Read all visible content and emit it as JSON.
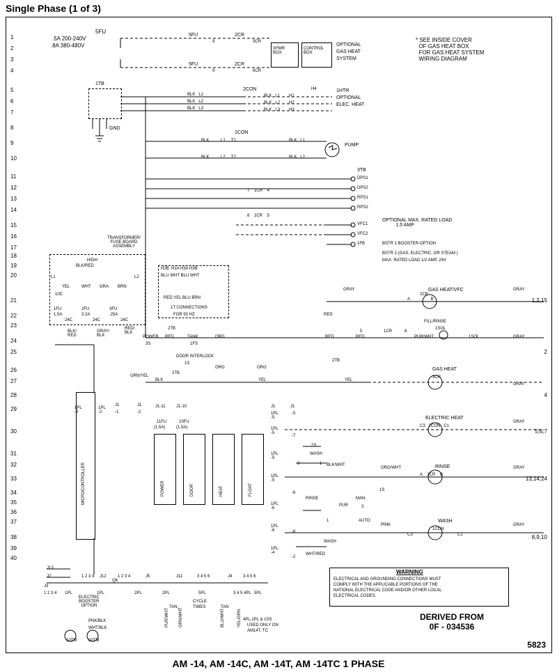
{
  "title": "Single Phase (1 of 3)",
  "caption": "AM -14, AM -14C, AM -14T, AM -14TC 1 PHASE",
  "drawing_no": "5823",
  "rows": [
    "1",
    "2",
    "3",
    "4",
    "5",
    "6",
    "7",
    "8",
    "9",
    "10",
    "11",
    "12",
    "13",
    "14",
    "15",
    "16",
    "17",
    "18",
    "19",
    "20",
    "21",
    "22",
    "23",
    "24",
    "25",
    "26",
    "27",
    "28",
    "29",
    "30",
    "31",
    "32",
    "33",
    "34",
    "35",
    "36",
    "37",
    "38",
    "39",
    "40"
  ],
  "row_ends": {
    "r21": "1,2,15",
    "r25": "2",
    "r28": "4",
    "r30": "5,6,7",
    "r33": "13,14,24",
    "r38": "8,9,10"
  },
  "labels": {
    "top_5fu1": "5FU",
    "top_5fu2": ".5A 200-240V",
    "top_5fu3": ".8A 380-480V",
    "xfmr": "XFMR\nBOX",
    "control_box": "CONTROL\nBOX",
    "optional_gas1": "OPTIONAL",
    "optional_gas2": "GAS HEAT",
    "optional_gas3": "SYSTEM",
    "tb1": "1TB",
    "tb2": "2TB",
    "tb3": "3TB",
    "con1": "1CON",
    "con2": "2CON",
    "blk_l1": "BLK   L1",
    "blk_l2": "BLK   L2",
    "blk_l3": "BLK   L3",
    "h1": "H1",
    "h2": "H2",
    "h3": "H3",
    "h4": "H4",
    "htr1": "1HTR",
    "optional_eh": "OPTIONAL",
    "elec_heat": "ELEC. HEAT",
    "gnd": "GND",
    "pump": "PUMP",
    "dps1": "DPS1",
    "dps2": "DPS2",
    "rps1": "RPS1",
    "rps2": "RPS2",
    "vfc1": "VFC1",
    "vfc2": "VFC2",
    "fb1": "1FB",
    "optional_amp": "OPTIONAL MAX. RATED LOAD\n          1.5 AMP",
    "xfmr_fuse": "TRANSFORMER/\nFUSE BOARD\nASSEMBLY",
    "high": "HIGH",
    "fu1": "1FU",
    "a1_5": "1.5A",
    "fu2": "2FU",
    "a3_2": "3.2A",
    "fu3": "3FU",
    "a25": ".25A",
    "c24": "24C",
    "c10": "10C",
    "t1_conn": "1T CONNECTIONS",
    "for50hz": "FOR 50 HZ",
    "bstr1": "BSTR 1 BOOSTER-OPTION",
    "bstr2": "BSTR 2 (GAS, ELECTRIC, OR STEAM )",
    "bstr2b": "MAX. RATED LOAD 1/2 AMP, 24V",
    "gas_heat_vfc": "GAS HEAT/VFC",
    "a_b": "A                  B",
    "cr2": "2CR",
    "cr1": "1CR",
    "cr3": "3CR",
    "fill_rinse": "FILL/RINSE",
    "sol1": "1SOL",
    "power": "POWER",
    "s3": "3S",
    "tank": "TANK",
    "fs1": "1FS",
    "door_int": "DOOR INTERLOCK",
    "s1": "1S",
    "gas_heat": "GAS HEAT",
    "elec_heat2": "ELECTRIC HEAT",
    "c3_2con": "C3   2CON   C1",
    "rinse": "RINSE",
    "rinse2": "RINSE",
    "a_1cr_b": "A    1CR    B",
    "s2": "2S",
    "wash": "WASH",
    "man": "MAN.",
    "auto": "AUTO",
    "micro": "MICROCONTROLLER",
    "j1": "J1",
    "j1_11": "J1-11",
    "j1_10": "J1-10",
    "fu11": "11FU",
    "fu11a": "(1.5A)",
    "fu10": "10FU",
    "fu10a": "(1.5A)",
    "ipl_2": "1PL\n-2",
    "ipl_3": "1PL\n-3",
    "ipl_4": "1PL\n-4",
    "ipl_5": "1PL\n-5",
    "ipl_6": "1PL\n-6",
    "neg2": "-2",
    "neg5": "-5",
    "neg6": "-6",
    "neg7": "-7",
    "power_v": "POWER",
    "door_v": "DOOR",
    "heat_v": "HEAT",
    "float_v": "FLOAT",
    "j13": "J13",
    "j2": "J2",
    "j3": "J3",
    "j12": "J12",
    "j5": "J5",
    "j11": "J11",
    "j4": "J4",
    "n1234": "1 2 3 4",
    "n3456": "3 4 5 6",
    "q6": "Q6",
    "pl1": "1PL",
    "pl2": "2PL",
    "pl5": "5PL",
    "ebooster": "ELECTRIC\nBOOSTER\nOPTION",
    "cycle_times": "CYCLE",
    "cycle_times2": "TIMES",
    "tm10": "10TM",
    "tm20": "20TM",
    "note_4pl": "4PL,1PL & 1SS",
    "used_on": "USED ONLY ON",
    "am14t": "AM14T, TC"
  },
  "netlabels": {
    "fu5a": "5FU",
    "fu5b": "5FU",
    "cr2a": "2CR",
    "cr2b": "2CR",
    "cr3": "3CR",
    "cr6": "6CR"
  },
  "colors": {
    "blk": "BLK",
    "blk_red": "BLK/RED",
    "red": "RED",
    "red_blk": "RED/\nBLK",
    "blk_red2": "BLK/\nRED",
    "yel": "YEL",
    "wht": "WHT",
    "gra": "GRA",
    "brn": "BRN",
    "gray": "GRAY",
    "org": "ORG",
    "tan": "TAN",
    "pur": "PUR",
    "pink": "PINK",
    "pur_wht": "PUR/WHT",
    "org_wht": "ORG/WHT",
    "orn_wht": "ORN/WHT",
    "blu_wht": "BLU/WHT",
    "yel_grn": "YEL/GRN",
    "grn_yel": "GRN/YEL",
    "wht_blk": "WHT/BLK",
    "pnk_blk": "PNK/BLK",
    "blk_wht": "BLK/WHT",
    "wht_red": "WHT/RED",
    "gray_blk": "GRAY/\nBLK"
  },
  "notes": {
    "inside_cover": "* SEE INSIDE COVER\n  OF GAS HEAT BOX\n  FOR GAS HEAT SYSTEM\n  WIRING DIAGRAM"
  },
  "warning": {
    "title": "WARNING",
    "l1": "ELECTRICAL AND GROUNDING CONNECTIONS MUST",
    "l2": "COMPLY WITH THE APPLICABLE PORTIONS OF THE",
    "l3": "NATIONAL ELECTRICAL CODE AND/OR OTHER LOCAL",
    "l4": "ELECTRICAL CODES."
  },
  "derived": {
    "l1": "DERIVED FROM",
    "l2": "0F - 034536"
  }
}
